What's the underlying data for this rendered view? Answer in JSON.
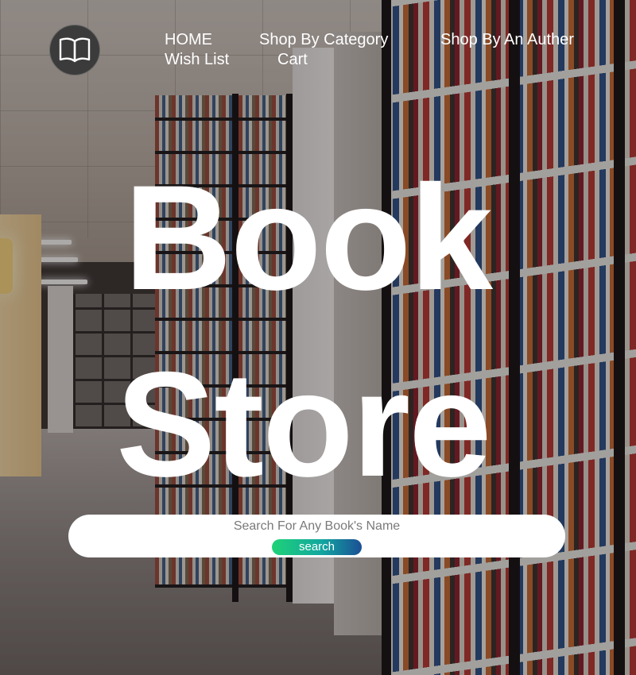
{
  "header": {
    "logo_icon": "open-book-icon",
    "nav": {
      "home": "HOME",
      "shop_by_category": "Shop By Category",
      "shop_by_author": "Shop By An Auther",
      "wish_list": "Wish List",
      "cart": "Cart"
    }
  },
  "hero": {
    "line1": "Book",
    "line2": "Store"
  },
  "search": {
    "placeholder": "Search For Any Book's Name",
    "value": "",
    "button_label": "search"
  },
  "colors": {
    "text": "#ffffff",
    "search_button_gradient": [
      "#1fd277",
      "#12a7a0",
      "#1b4f95"
    ],
    "logo_background": "#3b3b3b"
  }
}
